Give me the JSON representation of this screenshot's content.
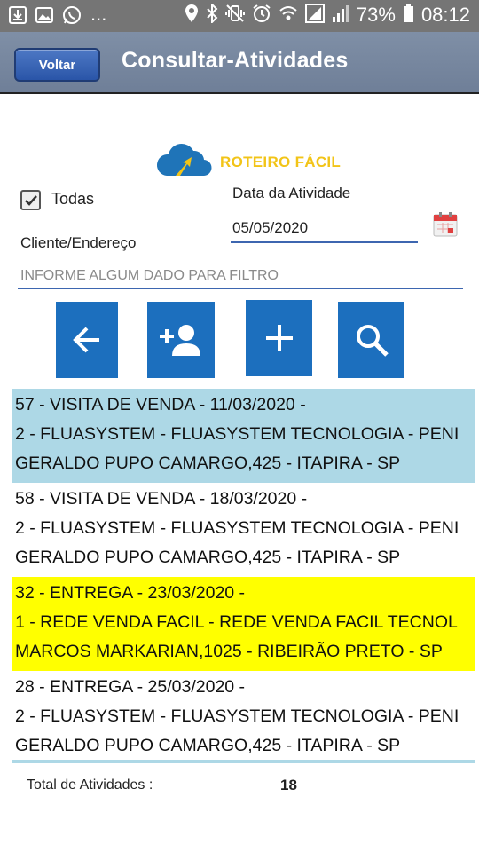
{
  "status_bar": {
    "dots": "...",
    "battery": "73%",
    "time": "08:12"
  },
  "header": {
    "back_label": "Voltar",
    "title": "Consultar-Atividades"
  },
  "logo": {
    "text": "ROTEIRO FÁCIL"
  },
  "filters": {
    "all_label": "Todas",
    "all_checked": true,
    "date_label": "Data da Atividade",
    "date_value": "05/05/2020",
    "client_label": "Cliente/Endereço",
    "filter_placeholder": "INFORME ALGUM DADO PARA FILTRO"
  },
  "actions": [
    {
      "icon": "arrow-left-icon"
    },
    {
      "icon": "add-person-icon"
    },
    {
      "icon": "plus-icon"
    },
    {
      "icon": "search-icon"
    }
  ],
  "activities": [
    {
      "line1": "57 - VISITA DE VENDA - 11/03/2020 -",
      "line2": "2 - FLUASYSTEM - FLUASYSTEM TECNOLOGIA - PENI",
      "line3": "GERALDO PUPO CAMARGO,425 - ITAPIRA - SP",
      "highlight": "#add8e6"
    },
    {
      "line1": "58 - VISITA DE VENDA - 18/03/2020 -",
      "line2": "2 - FLUASYSTEM - FLUASYSTEM TECNOLOGIA - PENI",
      "line3": "GERALDO PUPO CAMARGO,425 - ITAPIRA - SP",
      "highlight": "#ffffff"
    },
    {
      "line1": "32 - ENTREGA - 23/03/2020 -",
      "line2": "1 - REDE VENDA FACIL - REDE VENDA FACIL TECNOL",
      "line3": "MARCOS MARKARIAN,1025 - RIBEIRÃO PRETO - SP",
      "highlight": "#ffff00"
    },
    {
      "line1": "28 - ENTREGA - 25/03/2020 -",
      "line2": "2 - FLUASYSTEM - FLUASYSTEM TECNOLOGIA - PENI",
      "line3": "GERALDO PUPO CAMARGO,425 - ITAPIRA - SP",
      "highlight": "#ffffff"
    }
  ],
  "footer": {
    "total_label": "Total de Atividades :",
    "total_value": "18"
  }
}
